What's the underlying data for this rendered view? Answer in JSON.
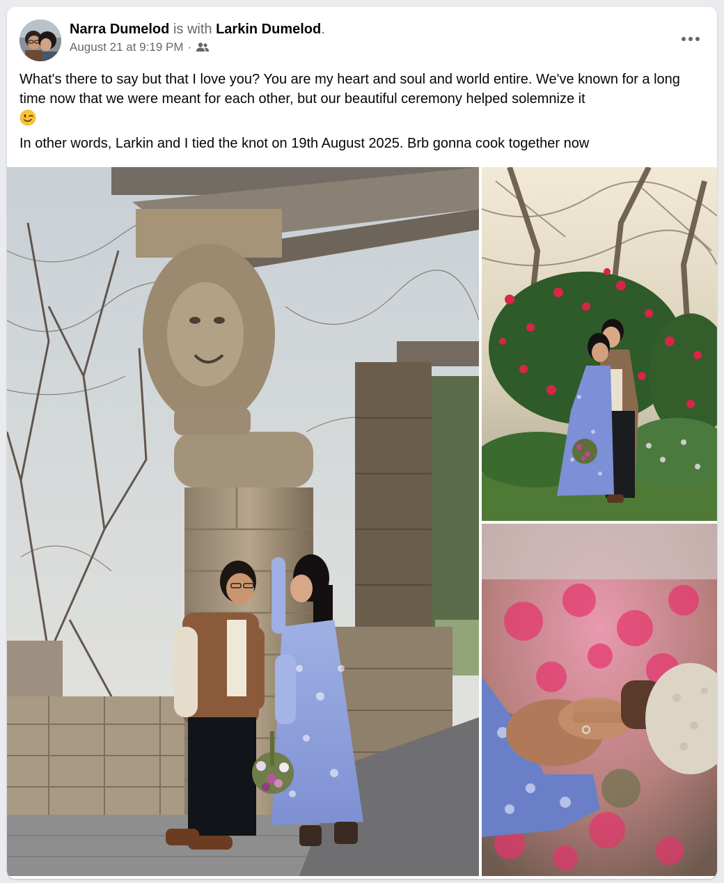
{
  "post": {
    "author": "Narra Dumelod",
    "with_text": "is with",
    "tagged": "Larkin Dumelod",
    "period": ".",
    "timestamp": "August 21 at 9:19 PM",
    "separator": "·",
    "audience_icon": "friends-icon",
    "more_icon": "more-options-icon",
    "paragraph1": "What's there to say but that I love you? You are my heart and soul and world entire. We've known for a long time now that we were meant for each other, but our beautiful ceremony helped solemnize it",
    "paragraph1_emoji": "winking-face-emoji",
    "paragraph2": "In other words, Larkin and I tied the knot on 19th August 2025. Brb gonna cook together now"
  },
  "photos": [
    {
      "name": "photo-couple-lion-pillar",
      "description_icon": "photo"
    },
    {
      "name": "photo-couple-embracing-garden",
      "description_icon": "photo"
    },
    {
      "name": "photo-hands-ring-closeup",
      "description_icon": "photo"
    }
  ],
  "colors": {
    "card_bg": "#ffffff",
    "page_bg": "#e9ebee",
    "primary_text": "#050505",
    "secondary_text": "#65676b"
  }
}
